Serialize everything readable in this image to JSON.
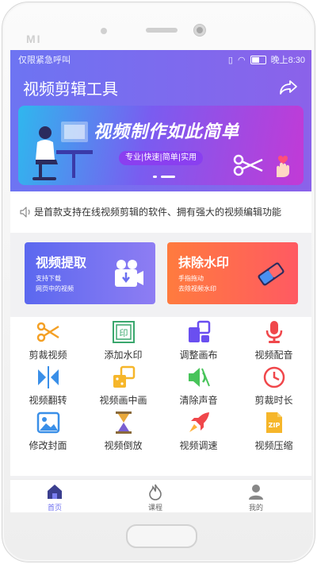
{
  "status_bar": {
    "carrier_text": "仅限紧急呼叫",
    "time": "晚上8:30"
  },
  "header": {
    "title": "视频剪辑工具"
  },
  "banner": {
    "title": "视频制作如此简单",
    "tags": "专业|快速|简单|实用",
    "slide_count": 2,
    "active_slide": 1
  },
  "notice": {
    "text": "是首款支持在线视频剪辑的软件、拥有强大的视频编辑功能"
  },
  "features": [
    {
      "title": "视频提取",
      "line1": "支持下载",
      "line2": "网页中的视频"
    },
    {
      "title": "抹除水印",
      "line1": "手指拖动",
      "line2": "去除视频水印"
    }
  ],
  "tools": [
    {
      "label": "剪裁视频",
      "icon": "scissors-icon",
      "color": "#f4a025"
    },
    {
      "label": "添加水印",
      "icon": "watermark-icon",
      "color": "#3aa76d"
    },
    {
      "label": "调整画布",
      "icon": "canvas-icon",
      "color": "#6a4ff0"
    },
    {
      "label": "视频配音",
      "icon": "microphone-icon",
      "color": "#f0474b"
    },
    {
      "label": "视频翻转",
      "icon": "flip-icon",
      "color": "#3a8fe8"
    },
    {
      "label": "视频画中画",
      "icon": "picture-in-picture-icon",
      "color": "#f6b62a"
    },
    {
      "label": "清除声音",
      "icon": "mute-speaker-icon",
      "color": "#48c45a"
    },
    {
      "label": "剪裁时长",
      "icon": "clock-icon",
      "color": "#f0474b"
    },
    {
      "label": "修改封面",
      "icon": "image-icon",
      "color": "#3a8fe8"
    },
    {
      "label": "视频倒放",
      "icon": "hourglass-icon",
      "color": "#e8a83a"
    },
    {
      "label": "视频调速",
      "icon": "rocket-icon",
      "color": "#f0474b"
    },
    {
      "label": "视频压缩",
      "icon": "zip-icon",
      "color": "#f6b62a"
    }
  ],
  "tabs": [
    {
      "label": "首页",
      "icon": "home-icon",
      "active": true
    },
    {
      "label": "课程",
      "icon": "flame-icon",
      "active": false
    },
    {
      "label": "我的",
      "icon": "user-icon",
      "active": false
    }
  ]
}
